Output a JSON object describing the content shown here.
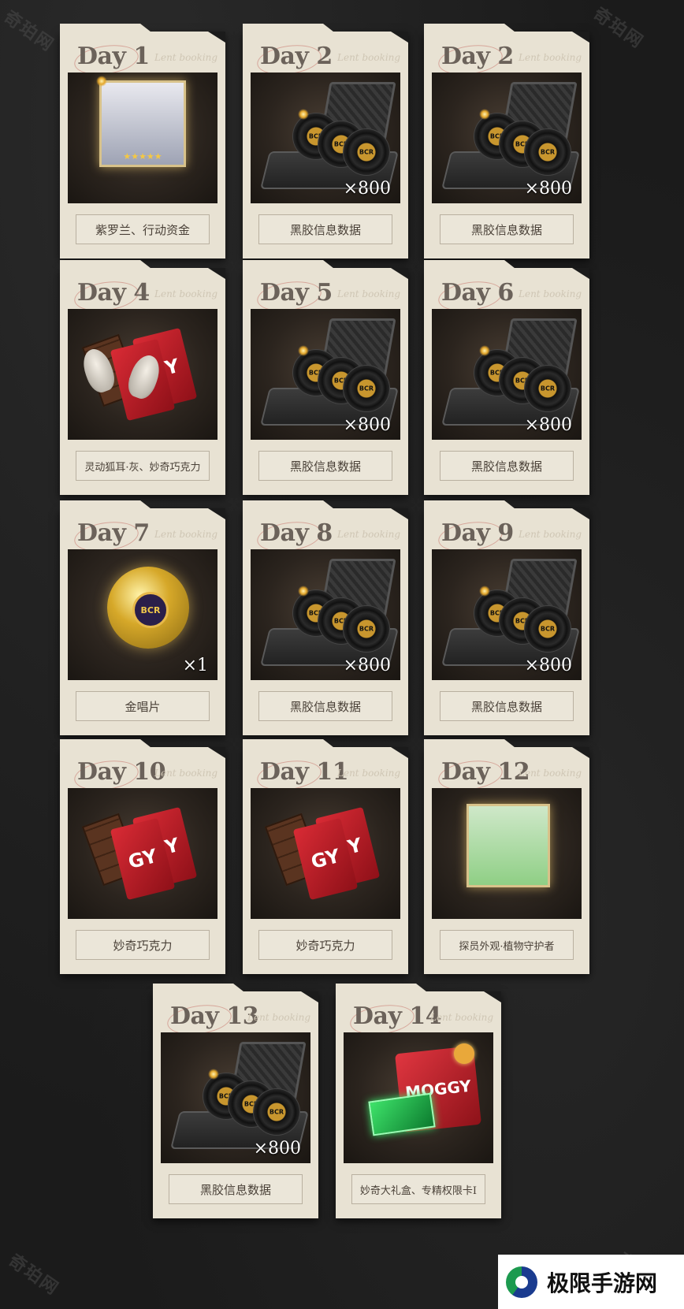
{
  "watermarks": [
    "奇珀网",
    "奇珀网",
    "奇珀网",
    "奇珀网"
  ],
  "cards": [
    {
      "day": "Day 1",
      "label": "紫罗兰、行动资金",
      "count": "",
      "art": "portrait-silver"
    },
    {
      "day": "Day 2",
      "label": "黑胶信息数据",
      "count": "×800",
      "art": "suitcase"
    },
    {
      "day": "Day 2",
      "label": "黑胶信息数据",
      "count": "×800",
      "art": "suitcase"
    },
    {
      "day": "Day 4",
      "label": "灵动狐耳·灰、妙奇巧克力",
      "count": "",
      "art": "fox-ears-chocolate"
    },
    {
      "day": "Day 5",
      "label": "黑胶信息数据",
      "count": "×800",
      "art": "suitcase"
    },
    {
      "day": "Day 6",
      "label": "黑胶信息数据",
      "count": "×800",
      "art": "suitcase"
    },
    {
      "day": "Day 7",
      "label": "金唱片",
      "count": "×1",
      "art": "gold-record"
    },
    {
      "day": "Day 8",
      "label": "黑胶信息数据",
      "count": "×800",
      "art": "suitcase"
    },
    {
      "day": "Day 9",
      "label": "黑胶信息数据",
      "count": "×800",
      "art": "suitcase"
    },
    {
      "day": "Day 10",
      "label": "妙奇巧克力",
      "count": "",
      "art": "chocolate"
    },
    {
      "day": "Day 11",
      "label": "妙奇巧克力",
      "count": "",
      "art": "chocolate"
    },
    {
      "day": "Day 12",
      "label": "探员外观·植物守护者",
      "count": "",
      "art": "portrait-green"
    },
    {
      "day": "Day 13",
      "label": "黑胶信息数据",
      "count": "×800",
      "art": "suitcase"
    },
    {
      "day": "Day 14",
      "label": "妙奇大礼盒、专精权限卡I",
      "count": "",
      "art": "gift-box"
    }
  ],
  "art_text": {
    "record_logo": "BCR",
    "chocolate_brand": "GY",
    "gift_brand": "MOGGY",
    "stars": "★★★★★",
    "scribble": "Lent booking"
  },
  "branding": {
    "site_name": "极限手游网"
  },
  "colors": {
    "background": "#1b1b1b",
    "card": "#e8e2d3",
    "day_text": "#6b625a",
    "accent_red": "#d92b35"
  }
}
